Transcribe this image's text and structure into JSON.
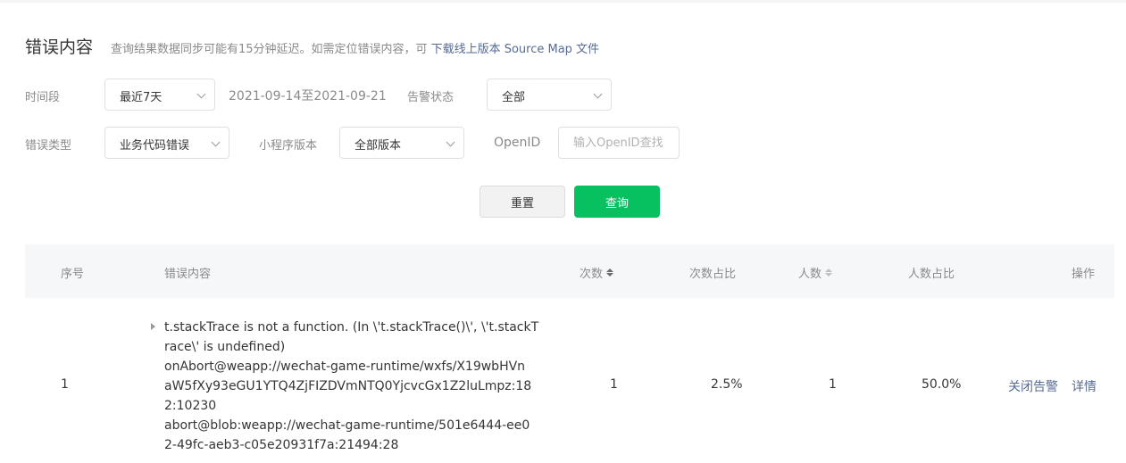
{
  "page": {
    "title": "错误内容",
    "tip": "查询结果数据同步可能有15分钟延迟。如需定位错误内容，可",
    "tip_link": "下载线上版本 Source Map 文件"
  },
  "filters": {
    "period_label": "时间段",
    "period_value": "最近7天",
    "date_range": "2021-09-14至2021-09-21",
    "alert_label": "告警状态",
    "alert_value": "全部",
    "error_type_label": "错误类型",
    "error_type_value": "业务代码错误",
    "version_label": "小程序版本",
    "version_value": "全部版本",
    "openid_label": "OpenID",
    "openid_placeholder": "输入OpenID查找",
    "reset_label": "重置",
    "query_label": "查询"
  },
  "table": {
    "columns": {
      "index": "序号",
      "content": "错误内容",
      "count": "次数",
      "count_ratio": "次数占比",
      "users": "人数",
      "users_ratio": "人数占比",
      "ops": "操作"
    },
    "rows": [
      {
        "index": "1",
        "content": "t.stackTrace is not a function. (In \\'t.stackTrace()\\', \\'t.stackT\nrace\\' is undefined)\nonAbort@weapp://wechat-game-runtime/wxfs/X19wbHVn\naW5fXy93eGU1YTQ4ZjFIZDVmNTQ0YjcvcGx1Z2luLmpz:18\n2:10230\nabort@blob:weapp://wechat-game-runtime/501e6444-ee0\n2-49fc-aeb3-c05e20931f7a:21494:28",
        "count": "1",
        "count_ratio": "2.5%",
        "users": "1",
        "users_ratio": "50.0%",
        "op_close_alert": "关闭告警",
        "op_detail": "详情"
      }
    ]
  },
  "icons": {
    "dropdown": "chevron-down-icon",
    "sort": "sort-icon",
    "expand": "caret-right-icon"
  },
  "colors": {
    "primary_button": "#07c160",
    "link": "#576b95",
    "table_header_bg": "#f6f7f9"
  }
}
